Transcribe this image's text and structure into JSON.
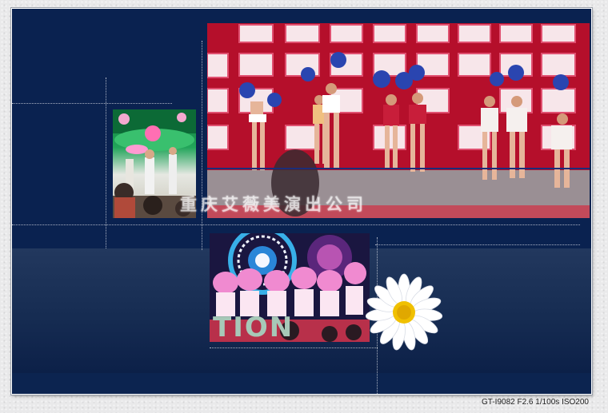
{
  "main_photo": {
    "caption": "重庆艾薇美演出公司"
  },
  "bottom_photo": {
    "overlay_text": "TION"
  },
  "exif": {
    "text": "GT-I9082 F2.6 1/100s ISO200"
  },
  "colors": {
    "background": "#0a2250",
    "stage_tile": "#c4102c",
    "daisy_center": "#f0c000"
  }
}
